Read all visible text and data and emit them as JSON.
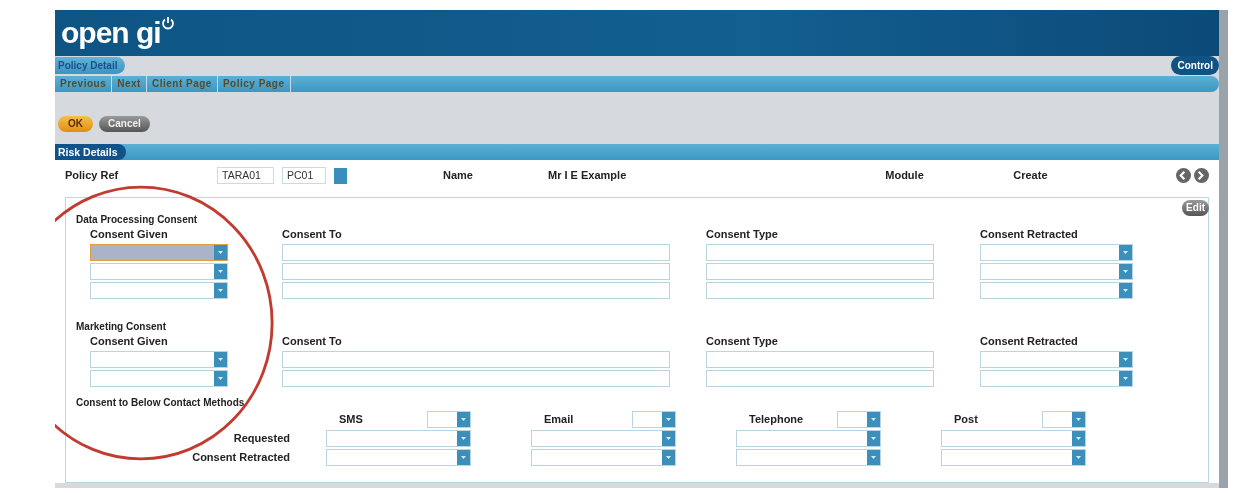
{
  "logo": {
    "text": "open gi"
  },
  "page_tab": "Policy Detail",
  "control_tab": "Control",
  "nav": [
    {
      "label": "Previous"
    },
    {
      "label": "Next"
    },
    {
      "label": "Client Page"
    },
    {
      "label": "Policy Page"
    }
  ],
  "buttons": [
    {
      "label": "OK",
      "kind": "primary"
    },
    {
      "label": "Cancel",
      "kind": "secondary"
    }
  ],
  "section_title": "Risk Details",
  "policy": {
    "label": "Policy Ref",
    "values": [
      "TARA01",
      "PC01"
    ],
    "name_label": "Name",
    "name_value": "Mr I E Example",
    "module_label": "Module",
    "module_value": "Create"
  },
  "edit_button": "Edit",
  "groups": [
    {
      "title": "Data Processing Consent",
      "columns": [
        "Consent Given",
        "Consent To",
        "Consent Type",
        "Consent Retracted"
      ],
      "rows": [
        {
          "focused": true
        },
        {
          "focused": false
        },
        {
          "focused": false
        }
      ]
    },
    {
      "title": "Marketing Consent",
      "columns": [
        "Consent Given",
        "Consent To",
        "Consent Type",
        "Consent Retracted"
      ],
      "rows": [
        {
          "focused": false
        },
        {
          "focused": false
        }
      ]
    }
  ],
  "contact": {
    "title": "Consent to Below Contact Methods",
    "methods": [
      "SMS",
      "Email",
      "Telephone",
      "Post"
    ],
    "row_labels": [
      "Requested",
      "Consent Retracted"
    ]
  }
}
